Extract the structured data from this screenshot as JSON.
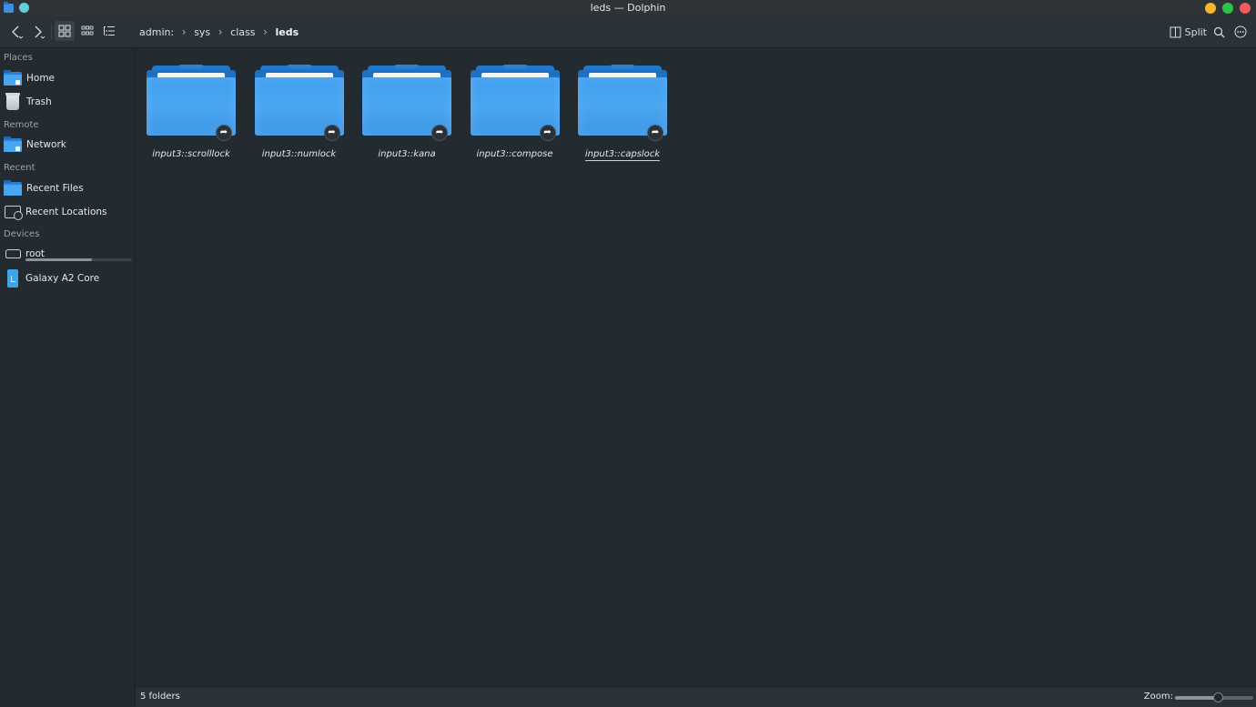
{
  "window": {
    "title": "leds — Dolphin",
    "colors": {
      "minimize": "#f4b62b",
      "maximize": "#2fc24a",
      "close": "#f05a5a"
    }
  },
  "toolbar": {
    "back_icon": "chevron-left-icon",
    "forward_icon": "chevron-right-icon",
    "split_label": "Split",
    "breadcrumb": [
      "admin:",
      "sys",
      "class",
      "leds"
    ]
  },
  "sidebar": {
    "sections": [
      {
        "title": "Places",
        "items": [
          {
            "label": "Home",
            "icon": "home-folder-icon"
          },
          {
            "label": "Trash",
            "icon": "trash-icon"
          }
        ]
      },
      {
        "title": "Remote",
        "items": [
          {
            "label": "Network",
            "icon": "network-folder-icon"
          }
        ]
      },
      {
        "title": "Recent",
        "items": [
          {
            "label": "Recent Files",
            "icon": "recent-files-folder-icon"
          },
          {
            "label": "Recent Locations",
            "icon": "recent-locations-icon"
          }
        ]
      },
      {
        "title": "Devices",
        "items": [
          {
            "label": "root",
            "icon": "drive-icon",
            "usage_fraction": 0.62
          },
          {
            "label": "Galaxy A2 Core",
            "icon": "phone-icon"
          }
        ]
      }
    ]
  },
  "files": [
    {
      "name": "input3::scrolllock",
      "type": "folder-link"
    },
    {
      "name": "input3::numlock",
      "type": "folder-link"
    },
    {
      "name": "input3::kana",
      "type": "folder-link"
    },
    {
      "name": "input3::compose",
      "type": "folder-link"
    },
    {
      "name": "input3::capslock",
      "type": "folder-link"
    }
  ],
  "statusbar": {
    "summary": "5 folders",
    "zoom_label": "Zoom:",
    "zoom_fraction": 0.55
  }
}
